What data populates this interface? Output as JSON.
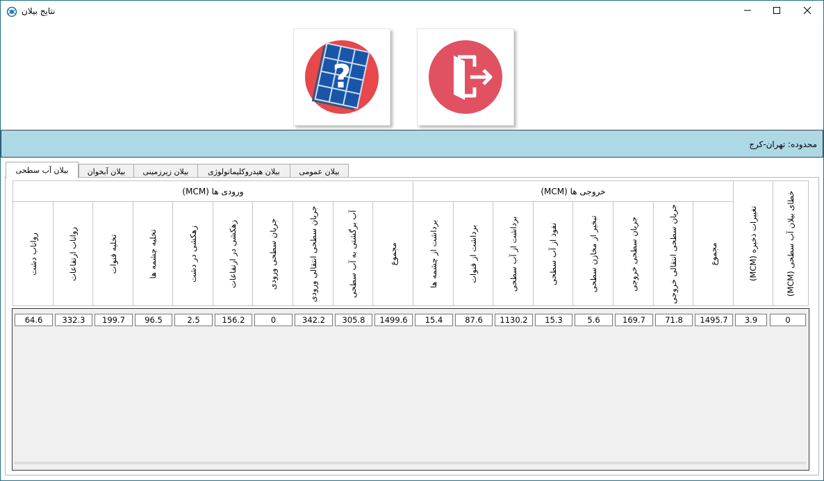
{
  "window": {
    "title": "نتایج بیلان",
    "app_icon": "globe-icon",
    "controls": [
      "minimize-icon",
      "maximize-icon",
      "close-icon"
    ]
  },
  "toolbar": {
    "help_icon": "help-grid-icon",
    "exit_icon": "exit-door-icon"
  },
  "region": {
    "text": "محدوده: تهران-کرج"
  },
  "tabs": [
    {
      "label": "بیلان آب سطحی",
      "active": true
    },
    {
      "label": "بیلان آبخوان",
      "active": false
    },
    {
      "label": "بیلان زیرزمینی",
      "active": false
    },
    {
      "label": "بیلان هیدروکلیماتولوژی",
      "active": false
    },
    {
      "label": "بیلان عمومی",
      "active": false
    }
  ],
  "table": {
    "group_inputs": "ورودی ها (MCM)",
    "group_outputs": "خروجی ها (MCM)",
    "columns": [
      "رواناب دشت",
      "رواناب ارتفاعات",
      "تخلیه قنوات",
      "تخلیه چشمه ها",
      "زهکشی در دشت",
      "زهکشی در ارتفاعات",
      "جریان سطحی ورودی",
      "جریان سطحی انتقالی ورودی",
      "آب برگشتی به آب سطحی",
      "مجموع",
      "برداشت از چشمه ها",
      "برداشت از قنوات",
      "برداشت از آب سطحی",
      "نفوذ از آب سطحی",
      "تبخیر از مخازن سطحی",
      "جریان سطحی خروجی",
      "جریان سطحی انتقالی خروجی",
      "مجموع",
      "تغییرات ذخیره (MCM)",
      "خطای بیلان آب سطحی (MCM)"
    ],
    "row": [
      "64.6",
      "332.3",
      "199.7",
      "96.5",
      "2.5",
      "156.2",
      "0",
      "342.2",
      "305.8",
      "1499.6",
      "15.4",
      "87.6",
      "1130.2",
      "15.3",
      "5.6",
      "169.7",
      "71.8",
      "1495.7",
      "3.9",
      "0"
    ]
  }
}
